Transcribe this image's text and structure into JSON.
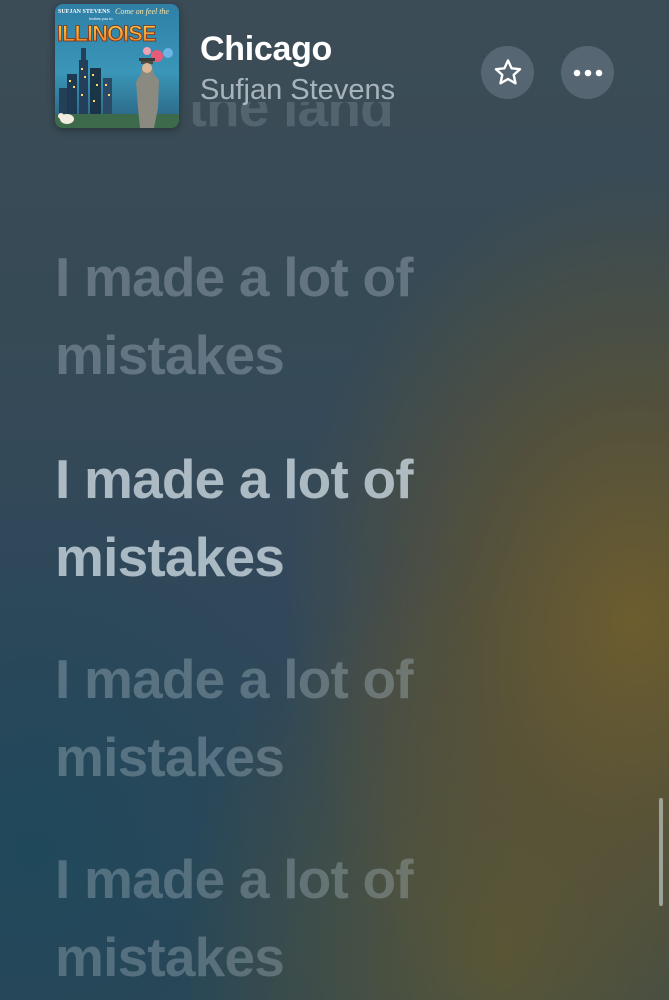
{
  "now_playing": {
    "title": "Chicago",
    "artist": "Sufjan Stevens",
    "artwork": {
      "line_top": "SUFJAN STEVENS",
      "script_text": "Come on feel the",
      "small_text": "Invites you to",
      "big_text": "ILLINOISE"
    }
  },
  "actions": {
    "favorite_icon": "star-icon",
    "more_icon": "ellipsis-icon"
  },
  "lyrics": [
    {
      "text": "from the land"
    },
    {
      "text": "I made a lot of mistakes"
    },
    {
      "text": "I made a lot of mistakes"
    },
    {
      "text": "I made a lot of mistakes"
    },
    {
      "text": "I made a lot of mistakes"
    }
  ],
  "active_lyric_index": 2,
  "colors": {
    "title": "#ffffff",
    "artist": "#cdd7de",
    "active_lyric": "#cddae2",
    "inactive_lyric": "#afbec8",
    "button_bg": "#78879480"
  }
}
